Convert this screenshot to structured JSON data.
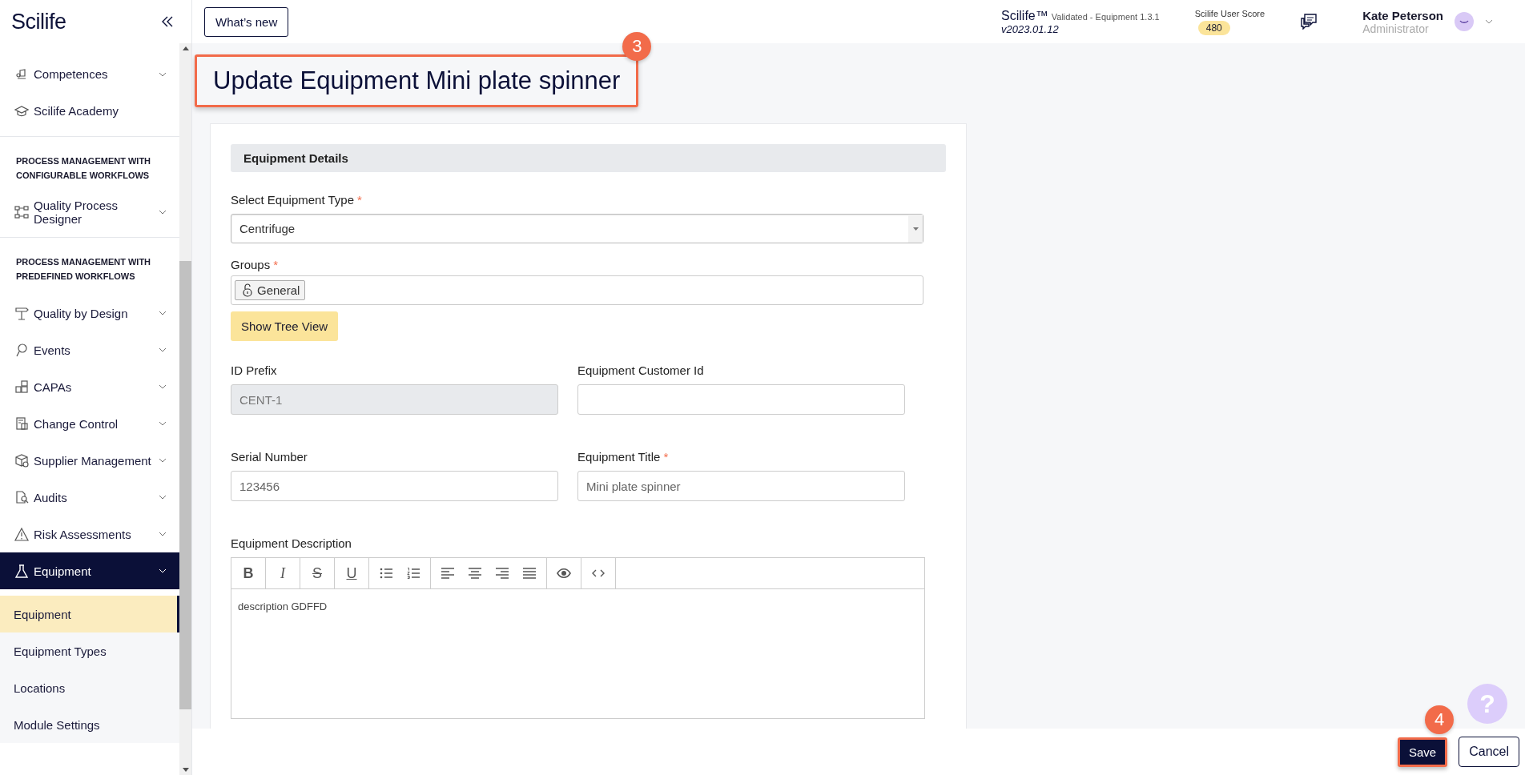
{
  "sidebar": {
    "logo": "Scilife",
    "items": [
      {
        "kind": "group",
        "label": "Competences",
        "selected": false
      },
      {
        "kind": "link",
        "label": "Scilife Academy",
        "selected": false
      },
      {
        "kind": "section",
        "label": "PROCESS MANAGEMENT WITH CONFIGURABLE WORKFLOWS"
      },
      {
        "kind": "group",
        "label": "Quality Process Designer",
        "selected": false
      },
      {
        "kind": "section",
        "label": "PROCESS MANAGEMENT WITH PREDEFINED WORKFLOWS"
      },
      {
        "kind": "group",
        "label": "Quality by Design",
        "selected": false
      },
      {
        "kind": "group",
        "label": "Events",
        "selected": false
      },
      {
        "kind": "group",
        "label": "CAPAs",
        "selected": false
      },
      {
        "kind": "group",
        "label": "Change Control",
        "selected": false
      },
      {
        "kind": "group",
        "label": "Supplier Management",
        "selected": false
      },
      {
        "kind": "group",
        "label": "Audits",
        "selected": false
      },
      {
        "kind": "group",
        "label": "Risk Assessments",
        "selected": false
      },
      {
        "kind": "group",
        "label": "Equipment",
        "selected": true,
        "children": [
          {
            "label": "Equipment",
            "selected": true
          },
          {
            "label": "Equipment Types",
            "selected": false
          },
          {
            "label": "Locations",
            "selected": false
          },
          {
            "label": "Module Settings",
            "selected": false
          }
        ]
      }
    ]
  },
  "topbar": {
    "whats_new": "What’s new",
    "product": {
      "name": "Scilife™",
      "validated": "Validated - Equipment 1.3.1",
      "version": "v2023.01.12"
    },
    "score": {
      "label": "Scilife User Score",
      "value": "480"
    },
    "user": {
      "name": "Kate Peterson",
      "role": "Administrator"
    }
  },
  "page": {
    "title": "Update Equipment Mini plate spinner",
    "title_step": "3"
  },
  "form": {
    "section_title": "Equipment Details",
    "equipment_type": {
      "label": "Select Equipment Type",
      "required_mark": "*",
      "value": "Centrifuge"
    },
    "groups": {
      "label": "Groups",
      "required_mark": "*",
      "tags": [
        {
          "label": "General",
          "locked": true
        }
      ]
    },
    "tree_button": "Show Tree View",
    "fields": [
      {
        "label": "ID Prefix",
        "value": "CENT-1",
        "disabled": true
      },
      {
        "label": "Equipment Customer Id",
        "disabled": false
      },
      {
        "label": "Serial Number",
        "value": "123456",
        "disabled": false
      },
      {
        "label": "Equipment Title",
        "required_mark": "*",
        "value": "Mini plate spinner",
        "disabled": false
      }
    ],
    "description": {
      "label": "Equipment Description",
      "text": "description GDFFD",
      "toolbar": [
        [
          {
            "kind": "bold",
            "glyph": "B"
          }
        ],
        [
          {
            "kind": "italic",
            "glyph": "I"
          }
        ],
        [
          {
            "kind": "strike",
            "glyph": "S"
          }
        ],
        [
          {
            "kind": "underline",
            "glyph": "U"
          }
        ],
        [
          {
            "kind": "bullets"
          },
          {
            "kind": "numbers"
          }
        ],
        [
          {
            "kind": "align-left"
          },
          {
            "kind": "align-center"
          },
          {
            "kind": "align-right"
          },
          {
            "kind": "justify"
          }
        ],
        [
          {
            "kind": "preview"
          }
        ],
        [
          {
            "kind": "code"
          }
        ]
      ]
    }
  },
  "footer": {
    "save": "Save",
    "save_step": "4",
    "cancel": "Cancel",
    "help": "?"
  }
}
